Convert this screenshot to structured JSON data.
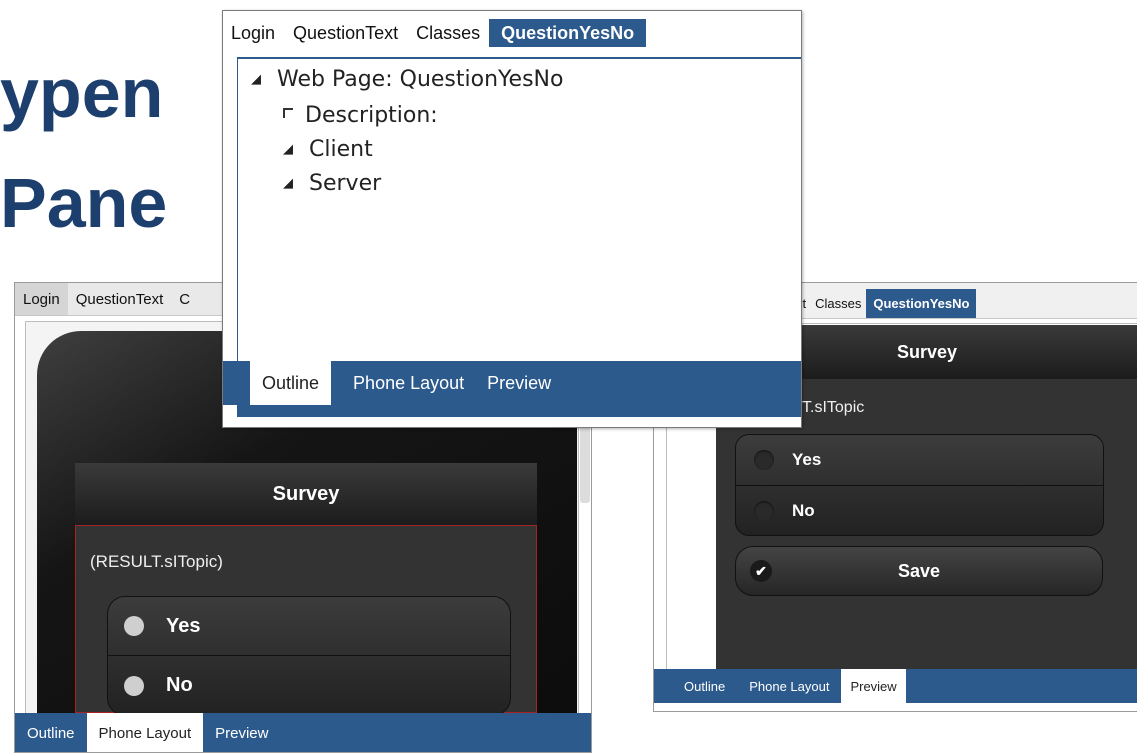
{
  "slide": {
    "title_line1": "ypen",
    "title_line2": "Pane"
  },
  "left_panel": {
    "tabs": [
      "Login",
      "QuestionText",
      "C"
    ],
    "bottom_tabs": [
      "Outline",
      "Phone Layout",
      "Preview"
    ],
    "active_bottom": "Phone Layout",
    "phone": {
      "header": "Survey",
      "topic": "(RESULT.sITopic)",
      "options": [
        "Yes",
        "No"
      ]
    }
  },
  "center_panel": {
    "tabs": [
      "Login",
      "QuestionText",
      "Classes",
      "QuestionYesNo"
    ],
    "active_tab": "QuestionYesNo",
    "tree": {
      "root": "Web Page: QuestionYesNo",
      "children": [
        "Description:",
        "Client",
        "Server"
      ]
    },
    "bottom_tabs": [
      "Outline",
      "Phone Layout",
      "Preview"
    ],
    "active_bottom": "Outline"
  },
  "right_panel": {
    "tabs": [
      "xt",
      "Classes",
      "QuestionYesNo"
    ],
    "active_tab": "QuestionYesNo",
    "phone": {
      "header": "Survey",
      "topic": "T.sITopic",
      "options": [
        "Yes",
        "No"
      ],
      "save_label": "Save"
    },
    "bottom_tabs": [
      "Outline",
      "Phone Layout",
      "Preview"
    ],
    "active_bottom": "Preview"
  },
  "colors": {
    "title": "#1d3f6e",
    "tab_active": "#2c5a8c",
    "bottom_bar": "#2c5a8c",
    "phone_bg": "#333333"
  }
}
